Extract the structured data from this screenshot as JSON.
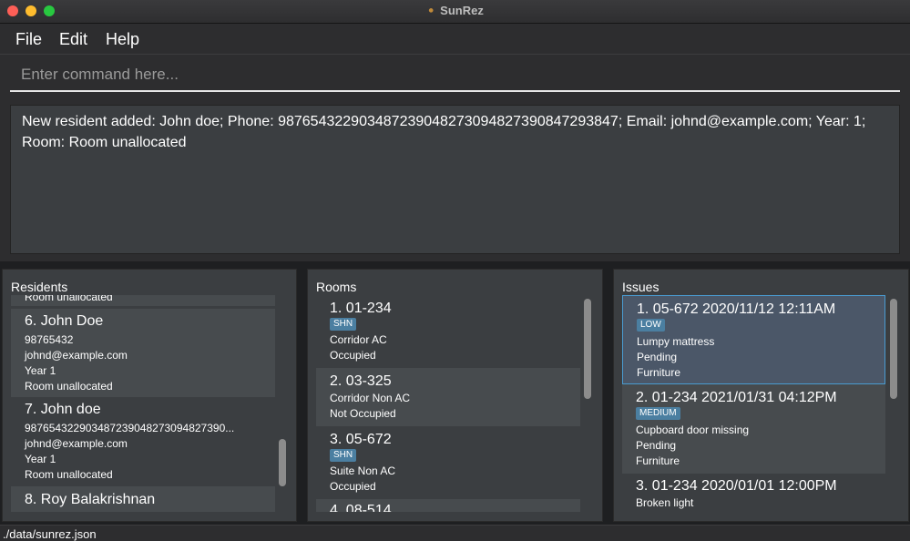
{
  "window": {
    "title": "SunRez"
  },
  "menu": {
    "items": [
      "File",
      "Edit",
      "Help"
    ]
  },
  "command": {
    "placeholder": "Enter command here...",
    "value": ""
  },
  "result": {
    "text": "New resident added: John doe; Phone: 9876543229034872390482730948273908472938​47; Email: johnd@example.com; Year: 1; Room: Room unallocated"
  },
  "residents": {
    "header": "Residents",
    "partial_top": "Room unallocated",
    "items": [
      {
        "title": "6.  John Doe",
        "phone": "98765432",
        "email": "johnd@example.com",
        "year": "Year 1",
        "room": "Room unallocated"
      },
      {
        "title": "7.  John doe",
        "phone": "98765432290348723904827309482739​0...",
        "email": "johnd@example.com",
        "year": "Year 1",
        "room": "Room unallocated"
      },
      {
        "title": "8.  Roy Balakrishnan"
      }
    ]
  },
  "rooms": {
    "header": "Rooms",
    "items": [
      {
        "title": "1.  01-234",
        "tag": "SHN",
        "type": "Corridor AC",
        "status": "Occupied"
      },
      {
        "title": "2.  03-325",
        "tag": "",
        "type": "Corridor Non AC",
        "status": "Not Occupied"
      },
      {
        "title": "3.  05-672",
        "tag": "SHN",
        "type": "Suite Non AC",
        "status": "Occupied"
      },
      {
        "title": "4.  08-514"
      }
    ]
  },
  "issues": {
    "header": "Issues",
    "items": [
      {
        "title": "1.  05-672  2020/11/12 12:11AM",
        "tag": "LOW",
        "desc": "Lumpy mattress",
        "status": "Pending",
        "category": "Furniture"
      },
      {
        "title": "2.  01-234  2021/01/31 04:12PM",
        "tag": "MEDIUM",
        "desc": "Cupboard door missing",
        "status": "Pending",
        "category": "Furniture"
      },
      {
        "title": "3.  01-234  2020/01/01 12:00PM",
        "desc": "Broken light"
      }
    ]
  },
  "status": {
    "path": "./data/sunrez.json"
  }
}
